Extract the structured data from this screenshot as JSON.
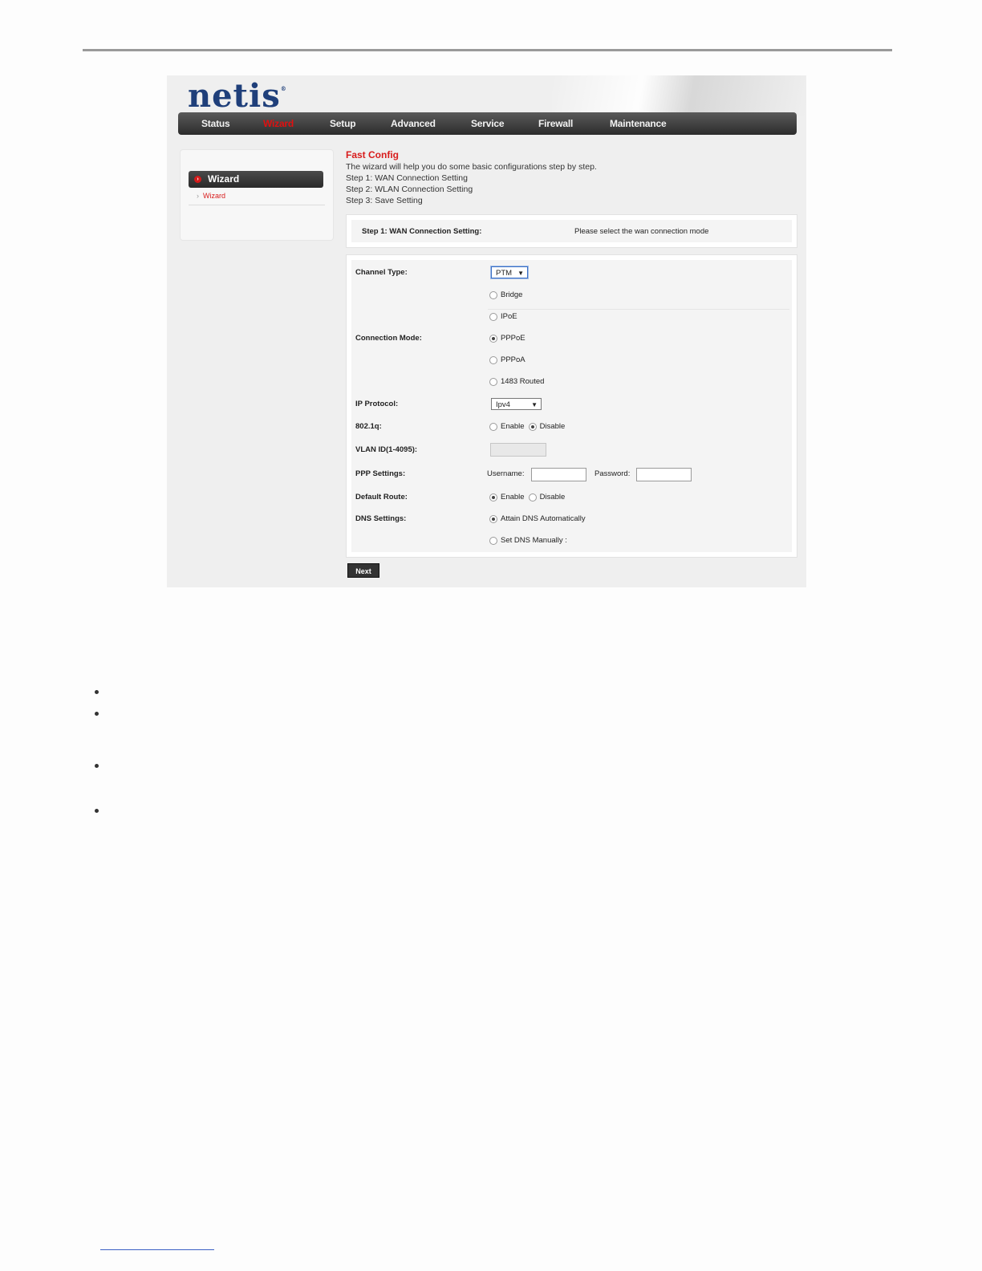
{
  "logo": {
    "text": "netis",
    "mark": "®"
  },
  "nav": {
    "items": [
      {
        "label": "Status",
        "active": false
      },
      {
        "label": "Wizard",
        "active": true
      },
      {
        "label": "Setup",
        "active": false
      },
      {
        "label": "Advanced",
        "active": false
      },
      {
        "label": "Service",
        "active": false
      },
      {
        "label": "Firewall",
        "active": false
      },
      {
        "label": "Maintenance",
        "active": false
      }
    ]
  },
  "sidebar": {
    "header": "Wizard",
    "link": "Wizard"
  },
  "fast_config": {
    "title": "Fast Config",
    "lines": [
      "The wizard will help you do some basic configurations step by step.",
      "Step 1: WAN Connection Setting",
      "Step 2: WLAN Connection Setting",
      "Step 3: Save Setting"
    ]
  },
  "step_panel": {
    "label": "Step 1: WAN Connection Setting:",
    "hint": "Please select the wan connection mode"
  },
  "form": {
    "channel_type": {
      "label": "Channel Type:",
      "value": "PTM"
    },
    "connection_mode": {
      "label": "Connection Mode:",
      "options": [
        "Bridge",
        "IPoE",
        "PPPoE",
        "PPPoA",
        "1483 Routed"
      ],
      "selected": "PPPoE"
    },
    "ip_protocol": {
      "label": "IP Protocol:",
      "value": "Ipv4"
    },
    "vlan_8021q": {
      "label": "802.1q:",
      "enable": "Enable",
      "disable": "Disable",
      "selected": "Disable"
    },
    "vlan_id": {
      "label": "VLAN ID(1-4095):",
      "value": ""
    },
    "ppp": {
      "label": "PPP Settings:",
      "username_label": "Username:",
      "password_label": "Password:",
      "username": "",
      "password": ""
    },
    "default_route": {
      "label": "Default Route:",
      "enable": "Enable",
      "disable": "Disable",
      "selected": "Enable"
    },
    "dns": {
      "label": "DNS Settings:",
      "auto": "Attain DNS Automatically",
      "manual": "Set DNS Manually :",
      "selected": "auto"
    }
  },
  "buttons": {
    "next": "Next"
  },
  "colors": {
    "brand": "#1f3f7a",
    "accent": "#d81c1c",
    "navbar": "#333333"
  }
}
